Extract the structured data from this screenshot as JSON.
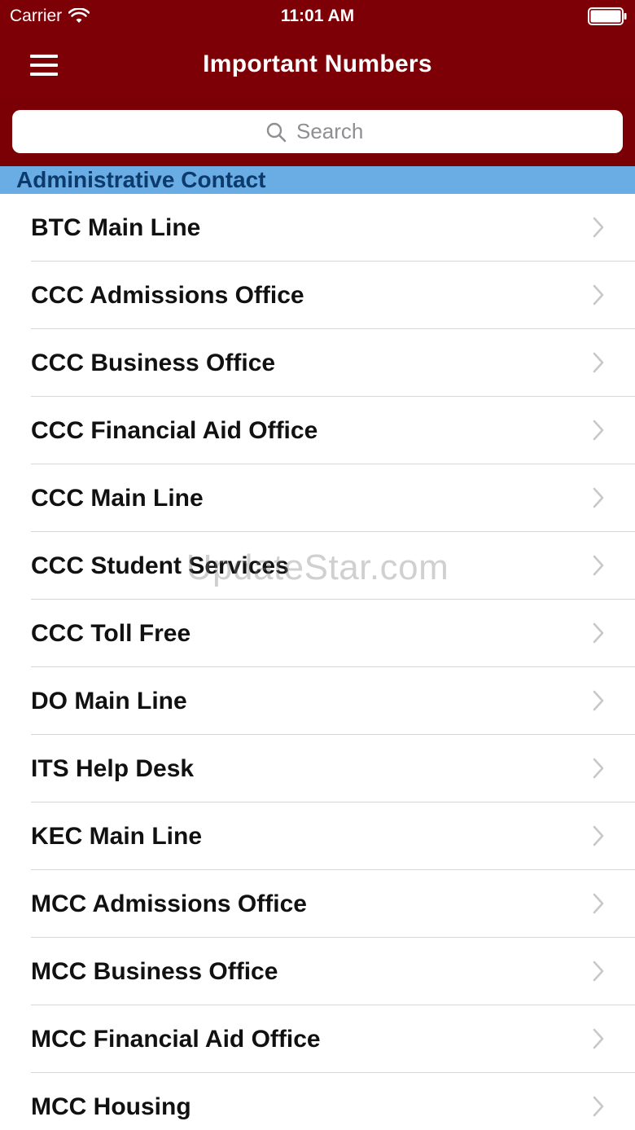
{
  "status_bar": {
    "carrier": "Carrier",
    "time": "11:01 AM",
    "wifi_icon": "wifi-icon",
    "battery_icon": "battery-icon"
  },
  "nav": {
    "title": "Important Numbers",
    "menu_icon": "hamburger-menu-icon"
  },
  "search": {
    "placeholder": "Search",
    "icon": "search-icon"
  },
  "section": {
    "title": "Administrative Contact"
  },
  "items": [
    {
      "label": "BTC Main Line"
    },
    {
      "label": "CCC Admissions Office"
    },
    {
      "label": "CCC Business Office"
    },
    {
      "label": "CCC Financial Aid Office"
    },
    {
      "label": "CCC Main Line"
    },
    {
      "label": "CCC Student Services"
    },
    {
      "label": "CCC Toll Free"
    },
    {
      "label": "DO Main Line"
    },
    {
      "label": "ITS Help Desk"
    },
    {
      "label": "KEC Main Line"
    },
    {
      "label": "MCC Admissions Office"
    },
    {
      "label": "MCC Business Office"
    },
    {
      "label": "MCC Financial Aid Office"
    },
    {
      "label": "MCC Housing"
    }
  ],
  "watermark": "UpdateStar.com",
  "colors": {
    "nav_background": "#7d0006",
    "section_header": "#6aace4",
    "section_text": "#0b3a6b"
  }
}
